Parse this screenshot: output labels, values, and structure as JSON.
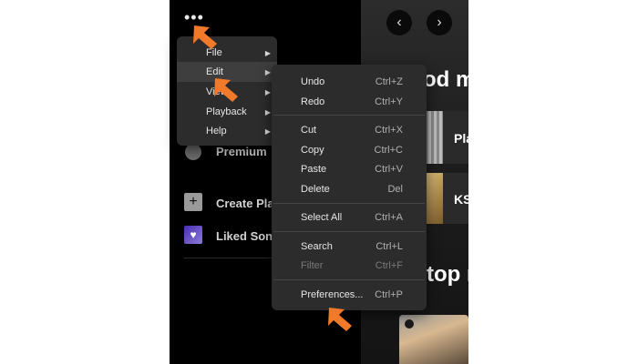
{
  "top": {
    "more_label": "•••"
  },
  "nav": {
    "back": "‹",
    "forward": "›"
  },
  "main": {
    "heading_1": "od m",
    "heading_2": "top m",
    "cards": [
      {
        "label": "Pla"
      },
      {
        "label": "KS"
      }
    ]
  },
  "sidebar": {
    "premium": "Premium",
    "create": "Create Pla",
    "liked": "Liked Song"
  },
  "menu1": {
    "items": [
      {
        "label": "File",
        "arrow": "▶"
      },
      {
        "label": "Edit",
        "arrow": "▶"
      },
      {
        "label": "View",
        "arrow": "▶"
      },
      {
        "label": "Playback",
        "arrow": "▶"
      },
      {
        "label": "Help",
        "arrow": "▶"
      }
    ]
  },
  "menu2": {
    "items": [
      {
        "label": "Undo",
        "shortcut": "Ctrl+Z"
      },
      {
        "label": "Redo",
        "shortcut": "Ctrl+Y"
      },
      {
        "label": "Cut",
        "shortcut": "Ctrl+X"
      },
      {
        "label": "Copy",
        "shortcut": "Ctrl+C"
      },
      {
        "label": "Paste",
        "shortcut": "Ctrl+V"
      },
      {
        "label": "Delete",
        "shortcut": "Del"
      },
      {
        "label": "Select All",
        "shortcut": "Ctrl+A"
      },
      {
        "label": "Search",
        "shortcut": "Ctrl+L"
      },
      {
        "label": "Filter",
        "shortcut": "Ctrl+F"
      },
      {
        "label": "Preferences...",
        "shortcut": "Ctrl+P"
      }
    ]
  },
  "colors": {
    "accent_arrow": "#f07a2a",
    "menu_bg": "#2c2c2c",
    "highlight": "#3e3e3e"
  }
}
